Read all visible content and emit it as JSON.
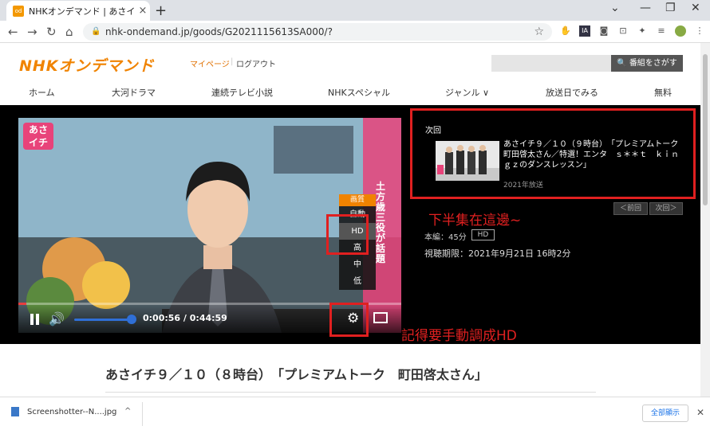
{
  "browser": {
    "tab_title": "NHKオンデマンド | あさイチ",
    "tab_favicon": "od",
    "new_tab": "+",
    "url": "nhk-ondemand.jp/goods/G2021115613SA000/?",
    "window_minimize": "—",
    "window_maximize": "❐",
    "window_close": "✕"
  },
  "site": {
    "logo": "NHKオンデマンド",
    "mypage": "マイページ",
    "separator": "|",
    "logout": "ログアウト",
    "search_button": "番組をさがす",
    "nav": [
      "ホーム",
      "大河ドラマ",
      "連続テレビ小説",
      "NHKスペシャル",
      "ジャンル ∨",
      "放送日でみる",
      "無料"
    ]
  },
  "player": {
    "show_logo_line1": "あさ",
    "show_logo_line2": "イチ",
    "overlay_text": "土方歳三役が話題",
    "elapsed": "0:00:56",
    "duration": "0:44:59",
    "progress_fraction": 0.021,
    "volume_fraction": 1.0,
    "quality_menu": {
      "header": "画質",
      "options": [
        "自動",
        "HD",
        "高",
        "中",
        "低"
      ],
      "selected": "HD"
    }
  },
  "next_episode": {
    "label": "次回",
    "title": "あさイチ９／１０（９時台）　「プレミアムトーク　町田啓太さん／特選！エンタ　ｓ＊＊ｔ　ｋｉｎｇｚのダンスレッスン」",
    "year": "2021年放送",
    "prev_button": "＜前回",
    "next_button": "次回＞"
  },
  "episode_info": {
    "duration_label": "本編：45分",
    "hd_badge": "HD",
    "deadline": "視聴期限：2021年9月21日 16時2分"
  },
  "annotations": {
    "next_note": "下半集在這邊~",
    "hd_note": "記得要手動調成HD"
  },
  "content": {
    "title": "あさイチ９／１０（８時台）　「プレミアムトーク　町田啓太さん」"
  },
  "downloads": {
    "filename": "Screenshotter--N....jpg",
    "show_all": "全部顯示"
  },
  "colors": {
    "brand_orange": "#f08300",
    "annotation_red": "#e02020",
    "volume_blue": "#2f6fd6"
  }
}
